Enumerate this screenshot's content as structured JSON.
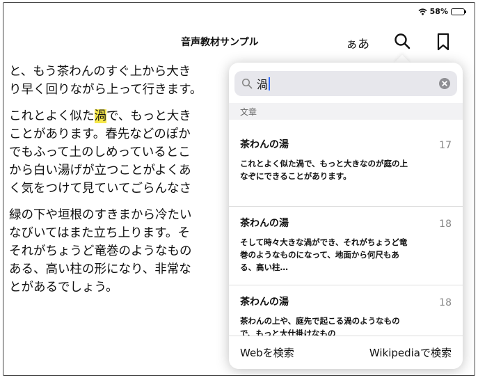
{
  "status": {
    "battery_text": "58%",
    "battery_level": 0.58
  },
  "toolbar": {
    "title": "音声教材サンプル",
    "font_label": "ぁあ"
  },
  "reader": {
    "lines": [
      "と、もう茶わんのすぐ上から大き",
      "り早く回りながら上って行きます。",
      "",
      "これとよく似た",
      "で、もっと大き",
      "ことがあります。春先などのぽか",
      "でもふって土のしめっているとこ",
      "から白い湯げが立つことがよくあ",
      "く気をつけて見ていてごらんなさ",
      "緑の下や垣根のすきまから冷たい",
      "なびいてはまた立ち上ります。そ",
      "それがちょうど竜巻のようなもの",
      "ある、高い柱の形になり、非常な",
      "とがあるでしょう。"
    ],
    "highlight": "渦"
  },
  "search": {
    "query": "渦",
    "section": "文章"
  },
  "results": [
    {
      "title": "茶わんの湯",
      "page": "17",
      "snippet": "これとよく似た渦で、もっと大きなのが庭の上なぞにできることがあります。"
    },
    {
      "title": "茶わんの湯",
      "page": "18",
      "snippet": "そして時々大きな渦ができ、それがちょうど竜巻のようなものになって、地面から何尺もある、高い柱…"
    },
    {
      "title": "茶わんの湯",
      "page": "18",
      "snippet": "茶わんの上や、庭先で起こる渦のようなもので、もっと大仕掛けなもの"
    }
  ],
  "footer": {
    "web_label": "Webを検索",
    "wiki_label": "Wikipediaで検索"
  }
}
